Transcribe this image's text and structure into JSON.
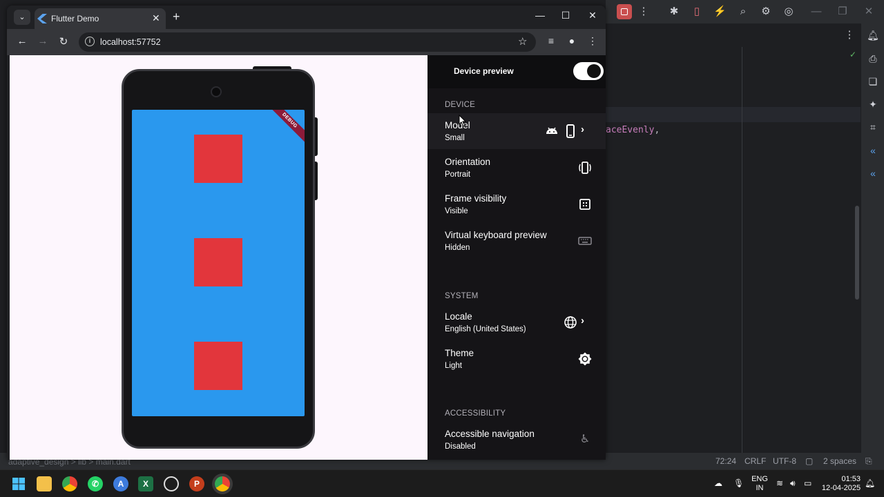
{
  "browser": {
    "tab_title": "Flutter Demo",
    "url": "localhost:57752"
  },
  "panel": {
    "title": "Device preview",
    "toggle_on": true,
    "sections": {
      "device": "DEVICE",
      "system": "SYSTEM",
      "accessibility": "ACCESSIBILITY"
    },
    "settings": {
      "model": {
        "title": "Model",
        "value": "Small"
      },
      "orientation": {
        "title": "Orientation",
        "value": "Portrait"
      },
      "frame": {
        "title": "Frame visibility",
        "value": "Visible"
      },
      "keyboard": {
        "title": "Virtual keyboard preview",
        "value": "Hidden"
      },
      "locale": {
        "title": "Locale",
        "value": "English (United States)"
      },
      "theme": {
        "title": "Theme",
        "value": "Light"
      },
      "accessible_nav": {
        "title": "Accessible navigation",
        "value": "Disabled"
      }
    }
  },
  "phone": {
    "debug_banner": "DEBUG",
    "screen_color": "#2a98ee",
    "square_color": "#e2363c"
  },
  "ide": {
    "code_fragment": "aceEvenly",
    "code_punct": ",",
    "breadcrumb": "adaptive_design  >  lib  >  main.dart",
    "status": {
      "position": "72:24",
      "line_ending": "CRLF",
      "encoding": "UTF-8",
      "indent": "2 spaces"
    }
  },
  "taskbar": {
    "lang_line1": "ENG",
    "lang_line2": "IN",
    "time": "01:53",
    "date": "12-04-2025"
  }
}
